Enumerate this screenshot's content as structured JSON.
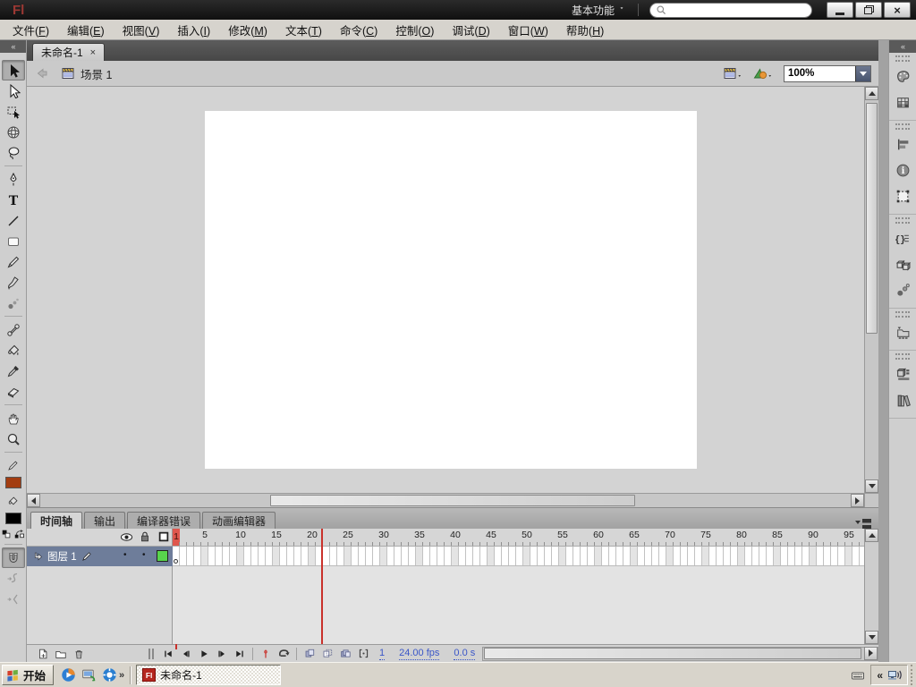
{
  "app": {
    "logo": "Fl",
    "workspace_switcher": "基本功能"
  },
  "titlebar": {
    "search_placeholder": "",
    "window_buttons": [
      "minimize",
      "restore",
      "close"
    ]
  },
  "menubar": {
    "items": [
      {
        "label": "文件",
        "mnemonic": "F"
      },
      {
        "label": "编辑",
        "mnemonic": "E"
      },
      {
        "label": "视图",
        "mnemonic": "V"
      },
      {
        "label": "插入",
        "mnemonic": "I"
      },
      {
        "label": "修改",
        "mnemonic": "M"
      },
      {
        "label": "文本",
        "mnemonic": "T"
      },
      {
        "label": "命令",
        "mnemonic": "C"
      },
      {
        "label": "控制",
        "mnemonic": "O"
      },
      {
        "label": "调试",
        "mnemonic": "D"
      },
      {
        "label": "窗口",
        "mnemonic": "W"
      },
      {
        "label": "帮助",
        "mnemonic": "H"
      }
    ]
  },
  "document_tab": {
    "title": "未命名-1",
    "close_glyph": "×"
  },
  "scene_bar": {
    "scene_name": "场景 1",
    "zoom_value": "100%"
  },
  "tools": {
    "selected": "selection",
    "items": [
      "selection",
      "subselection",
      "free-transform",
      "3d-rotation",
      "lasso",
      "|",
      "pen",
      "text",
      "line",
      "rectangle",
      "pencil",
      "brush",
      "deco",
      "|",
      "bone",
      "paint-bucket",
      "eyedropper",
      "eraser",
      "|",
      "hand",
      "zoom",
      "|"
    ],
    "stroke_color": "#A33D11",
    "fill_color": "#000000",
    "options": [
      "snap-magnet",
      "smooth",
      "straighten"
    ],
    "snap_selected": true
  },
  "dock": {
    "groups": [
      [
        "color-palette",
        "swatches"
      ],
      [
        "align",
        "info",
        "transform"
      ],
      [
        "code-snippets",
        "components",
        "motion-presets"
      ],
      [
        "project"
      ],
      [
        "library",
        "help-books"
      ]
    ]
  },
  "timeline": {
    "tabs": [
      {
        "label": "时间轴",
        "active": true
      },
      {
        "label": "输出",
        "active": false
      },
      {
        "label": "编译器错误",
        "active": false
      },
      {
        "label": "动画编辑器",
        "active": false
      }
    ],
    "layer": {
      "name": "图层 1",
      "selected": true,
      "outline_color": "#58D44C"
    },
    "ruler_numbers": [
      "5",
      "10",
      "15",
      "20",
      "25",
      "30",
      "35",
      "40",
      "45",
      "50",
      "55",
      "60",
      "65",
      "70",
      "75",
      "80",
      "85",
      "90",
      "95"
    ],
    "current_frame": "1",
    "frame_rate": "24.00 fps",
    "elapsed_time": "0.0 s"
  },
  "taskbar": {
    "start_label": "开始",
    "quick_launch": [
      "media-player",
      "show-desktop",
      "messenger"
    ],
    "overflow_glyph": "»",
    "task": {
      "icon_label": "Fl",
      "title": "未命名-1",
      "active": true
    },
    "tray_collapse_glyph": "«"
  },
  "colors": {
    "titlebar": "#141414",
    "accent_red": "#C9312B",
    "selected_layer_row": "#6E7D9A",
    "stage": "#FFFFFF",
    "pasteboard": "#D3D3D3"
  }
}
